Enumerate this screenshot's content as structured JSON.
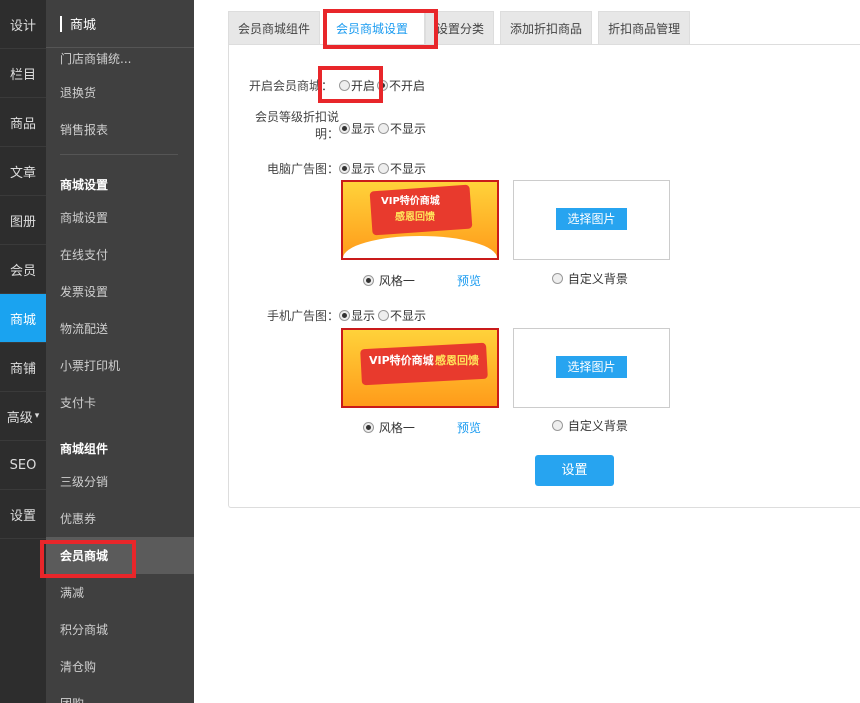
{
  "nav1": [
    "设计",
    "栏目",
    "商品",
    "文章",
    "图册",
    "会员",
    "商城",
    "商铺",
    "高级",
    "SEO",
    "设置"
  ],
  "nav1_caret": "▾",
  "nav2": {
    "header": "商城",
    "items_top": [
      "门店商铺统...",
      "退换货",
      "销售报表"
    ],
    "section1": "商城设置",
    "items_mid": [
      "商城设置",
      "在线支付",
      "发票设置",
      "物流配送",
      "小票打印机",
      "支付卡"
    ],
    "section2": "商城组件",
    "items_bottom": [
      "三级分销",
      "优惠券",
      "会员商城",
      "满减",
      "积分商城",
      "清仓购",
      "团购"
    ]
  },
  "tabs": [
    "会员商城组件",
    "会员商城设置",
    "设置分类",
    "添加折扣商品",
    "折扣商品管理"
  ],
  "form": {
    "open_label": "开启会员商城：",
    "open_on": "开启",
    "open_off": "不开启",
    "discount_label_1": "会员等级折扣说",
    "discount_label_2": "明：",
    "show": "显示",
    "hide": "不显示",
    "pc_ad_label": "电脑广告图：",
    "mobile_ad_label": "手机广告图：",
    "style_one": "风格一",
    "preview": "预览",
    "custom_bg": "自定义背景",
    "pick_image": "选择图片",
    "submit": "设置"
  },
  "banner": {
    "pc_line1": "VIP特价商城",
    "pc_line2": "感恩回馈",
    "mobile_line1": "VIP特价商城",
    "mobile_line2": "感恩回馈"
  },
  "colors": {
    "accent": "#1aa3f0",
    "highlight": "#e8262a",
    "sidebar_dark": "#2d2d2d",
    "sidebar": "#404040"
  }
}
